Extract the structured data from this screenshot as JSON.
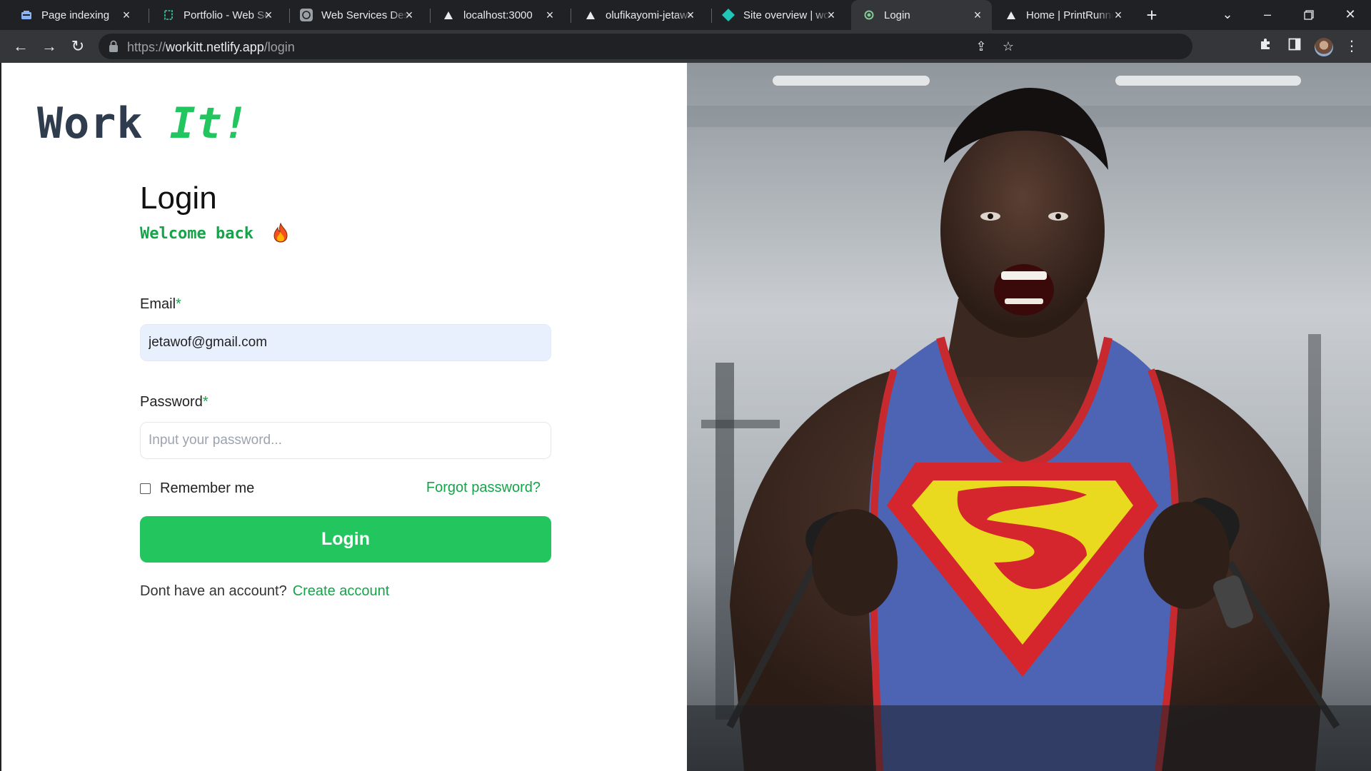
{
  "browser": {
    "tabs": [
      {
        "title": "Page indexing",
        "icon": "search-console-icon",
        "active": false
      },
      {
        "title": "Portfolio - Web Services",
        "icon": "portfolio-icon",
        "active": false
      },
      {
        "title": "Web Services Design",
        "icon": "openai-icon",
        "active": false
      },
      {
        "title": "localhost:3000",
        "icon": "triangle-icon",
        "active": false
      },
      {
        "title": "olufikayomi-jetawo",
        "icon": "triangle-icon",
        "active": false
      },
      {
        "title": "Site overview | workitt",
        "icon": "netlify-icon",
        "active": false
      },
      {
        "title": "Login",
        "icon": "loading-dot-icon",
        "active": true
      },
      {
        "title": "Home | PrintRunner",
        "icon": "triangle-icon",
        "active": false
      }
    ],
    "url_scheme": "https://",
    "url_host": "workitt.netlify.app",
    "url_path": "/login",
    "colors": {
      "chrome_dark": "#202124",
      "chrome_toolbar": "#35363a"
    }
  },
  "page": {
    "logo_main": "Work ",
    "logo_accent": "It!",
    "heading": "Login",
    "welcome": "Welcome back",
    "email_label": "Email",
    "email_value": "jetawof@gmail.com",
    "password_label": "Password",
    "password_placeholder": "Input your password...",
    "required_mark": "*",
    "remember_label": "Remember me",
    "forgot_label": "Forgot password?",
    "login_button": "Login",
    "no_account_text": "Dont have an account?",
    "create_account_label": "Create account",
    "colors": {
      "accent": "#22c55e",
      "accent_dark": "#16a34a",
      "logo_text": "#2f3c4d"
    }
  }
}
